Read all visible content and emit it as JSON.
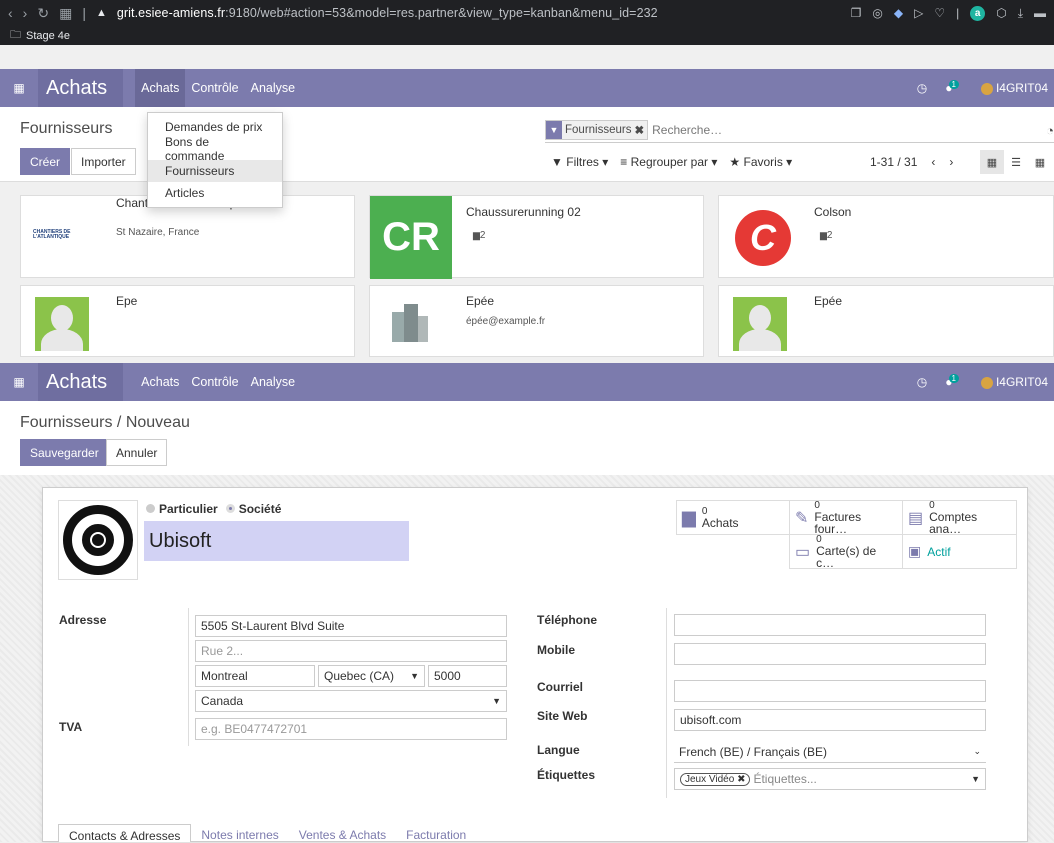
{
  "browser": {
    "url_host": "grit.esiee-amiens.fr",
    "url_rest": ":9180/web#action=53&model=res.partner&view_type=kanban&menu_id=232",
    "bookmark": "Stage 4e"
  },
  "navbar": {
    "app": "Achats",
    "menus": [
      "Achats",
      "Contrôle",
      "Analyse"
    ],
    "notif_count": "1",
    "user": "I4GRIT04"
  },
  "list_view": {
    "title": "Fournisseurs",
    "create_label": "Créer",
    "import_label": "Importer",
    "facet": "Fournisseurs",
    "search_placeholder": "Recherche…",
    "filters": "Filtres",
    "group_by": "Regrouper par",
    "favorites": "Favoris",
    "pager": "1-31 / 31",
    "dropdown": [
      "Demandes de prix",
      "Bons de commande",
      "Fournisseurs",
      "Articles"
    ],
    "cards": [
      {
        "name": "Chantiers de l'Atlantique",
        "sub": "St Nazaire, France",
        "logo_text": "CHANTIERS DE L'ATLANTIQUE"
      },
      {
        "name": "Chaussurerunning 02",
        "sub": "2",
        "logo_text": "CR"
      },
      {
        "name": "Colson",
        "sub": "2"
      },
      {
        "name": "Epe",
        "sub": ""
      },
      {
        "name": "Epée",
        "sub": "épée@example.fr"
      },
      {
        "name": "Epée",
        "sub": ""
      }
    ]
  },
  "form_view": {
    "title": "Fournisseurs / Nouveau",
    "save_label": "Sauvegarder",
    "discard_label": "Annuler",
    "type_individual": "Particulier",
    "type_company": "Société",
    "company_name": "Ubisoft",
    "stats": [
      {
        "num": "0",
        "label": "Achats"
      },
      {
        "num": "0",
        "label": "Factures four…"
      },
      {
        "num": "0",
        "label": "Comptes ana…"
      },
      {
        "num": "0",
        "label": "Carte(s) de c…"
      },
      {
        "num": "",
        "label": "Actif"
      }
    ],
    "address_label": "Adresse",
    "street": "5505 St-Laurent Blvd Suite",
    "street2_placeholder": "Rue 2...",
    "city": "Montreal",
    "state": "Quebec (CA)",
    "zip": "5000",
    "country": "Canada",
    "vat_label": "TVA",
    "vat_placeholder": "e.g. BE0477472701",
    "phone_label": "Téléphone",
    "mobile_label": "Mobile",
    "email_label": "Courriel",
    "website_label": "Site Web",
    "website": "ubisoft.com",
    "lang_label": "Langue",
    "lang": "French (BE) / Français (BE)",
    "tags_label": "Étiquettes",
    "tag": "Jeux Vidéo",
    "tags_placeholder": "Étiquettes...",
    "tabs": [
      "Contacts & Adresses",
      "Notes internes",
      "Ventes & Achats",
      "Facturation"
    ]
  },
  "colors": {
    "primary": "#7c7bad",
    "teal": "#00a09d",
    "green_tile": "#4caf50"
  }
}
